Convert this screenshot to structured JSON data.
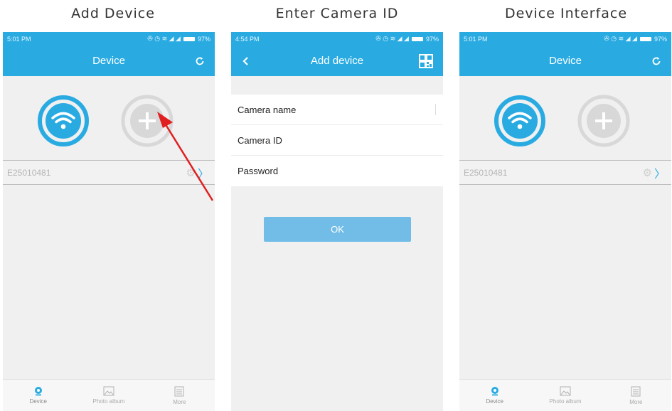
{
  "captions": [
    "Add Device",
    "Enter Camera ID",
    "Device Interface"
  ],
  "screens": [
    {
      "status_time": "5:01 PM",
      "battery": "97%",
      "title": "Device",
      "device_id": "E25010481",
      "tabs": [
        "Device",
        "Photo album",
        "More"
      ]
    },
    {
      "status_time": "4:54 PM",
      "battery": "97%",
      "title": "Add device",
      "fields": [
        "Camera name",
        "Camera ID",
        "Password"
      ],
      "ok_label": "OK"
    },
    {
      "status_time": "5:01 PM",
      "battery": "97%",
      "title": "Device",
      "device_id": "E25010481",
      "tabs": [
        "Device",
        "Photo album",
        "More"
      ]
    }
  ],
  "colors": {
    "header": "#29abe2",
    "button": "#72bde8",
    "arrow": "#e02020",
    "active_tab": "#29abe2"
  },
  "icons": [
    "wifi-icon",
    "add-icon",
    "refresh-icon",
    "back-icon",
    "qr-code-icon",
    "settings-icon",
    "chevron-right-icon",
    "camera-icon",
    "photo-album-icon",
    "more-icon"
  ]
}
